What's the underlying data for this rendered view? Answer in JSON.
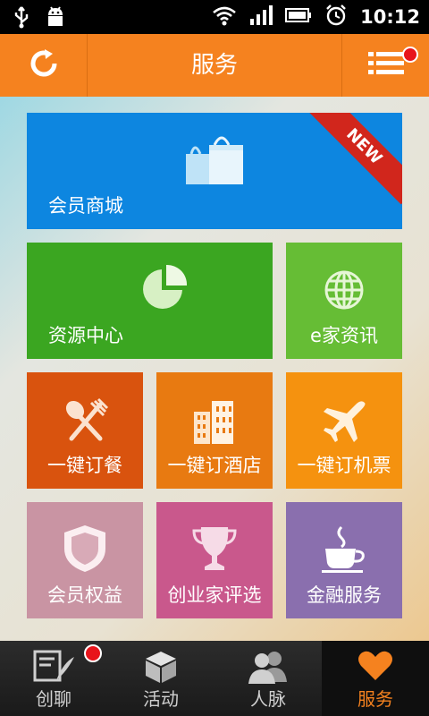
{
  "status_bar": {
    "time": "10:12",
    "icons": [
      "usb-icon",
      "android-debug-icon",
      "wifi-icon",
      "signal-icon",
      "battery-icon",
      "alarm-icon"
    ]
  },
  "header": {
    "title": "服务",
    "left_icon": "refresh-icon",
    "right_icon": "list-menu-icon",
    "notification": true
  },
  "tiles": {
    "mall": {
      "label": "会员商城",
      "badge": "NEW",
      "icon": "shopping-bags-icon",
      "color": "#0d86e0"
    },
    "resource": {
      "label": "资源中心",
      "icon": "pie-chart-icon",
      "color": "#3ba621"
    },
    "news": {
      "label": "e家资讯",
      "icon": "globe-icon",
      "color": "#66bd35"
    },
    "meal": {
      "label": "一键订餐",
      "icon": "fork-spoon-icon",
      "color": "#d9530e"
    },
    "hotel": {
      "label": "一键订酒店",
      "icon": "buildings-icon",
      "color": "#e87a11"
    },
    "flight": {
      "label": "一键订机票",
      "icon": "airplane-icon",
      "color": "#f5920f"
    },
    "rights": {
      "label": "会员权益",
      "icon": "shield-icon",
      "color": "#c994a3"
    },
    "contest": {
      "label": "创业家评选",
      "icon": "trophy-icon",
      "color": "#c9588c"
    },
    "finance": {
      "label": "金融服务",
      "icon": "coffee-cup-icon",
      "color": "#8a6fae"
    }
  },
  "tabbar": {
    "items": [
      {
        "label": "创聊",
        "icon": "chat-quill-icon",
        "notification": true
      },
      {
        "label": "活动",
        "icon": "cube-icon"
      },
      {
        "label": "人脉",
        "icon": "people-icon"
      },
      {
        "label": "服务",
        "icon": "heart-icon",
        "active": true
      }
    ],
    "active_color": "#f5821f"
  }
}
